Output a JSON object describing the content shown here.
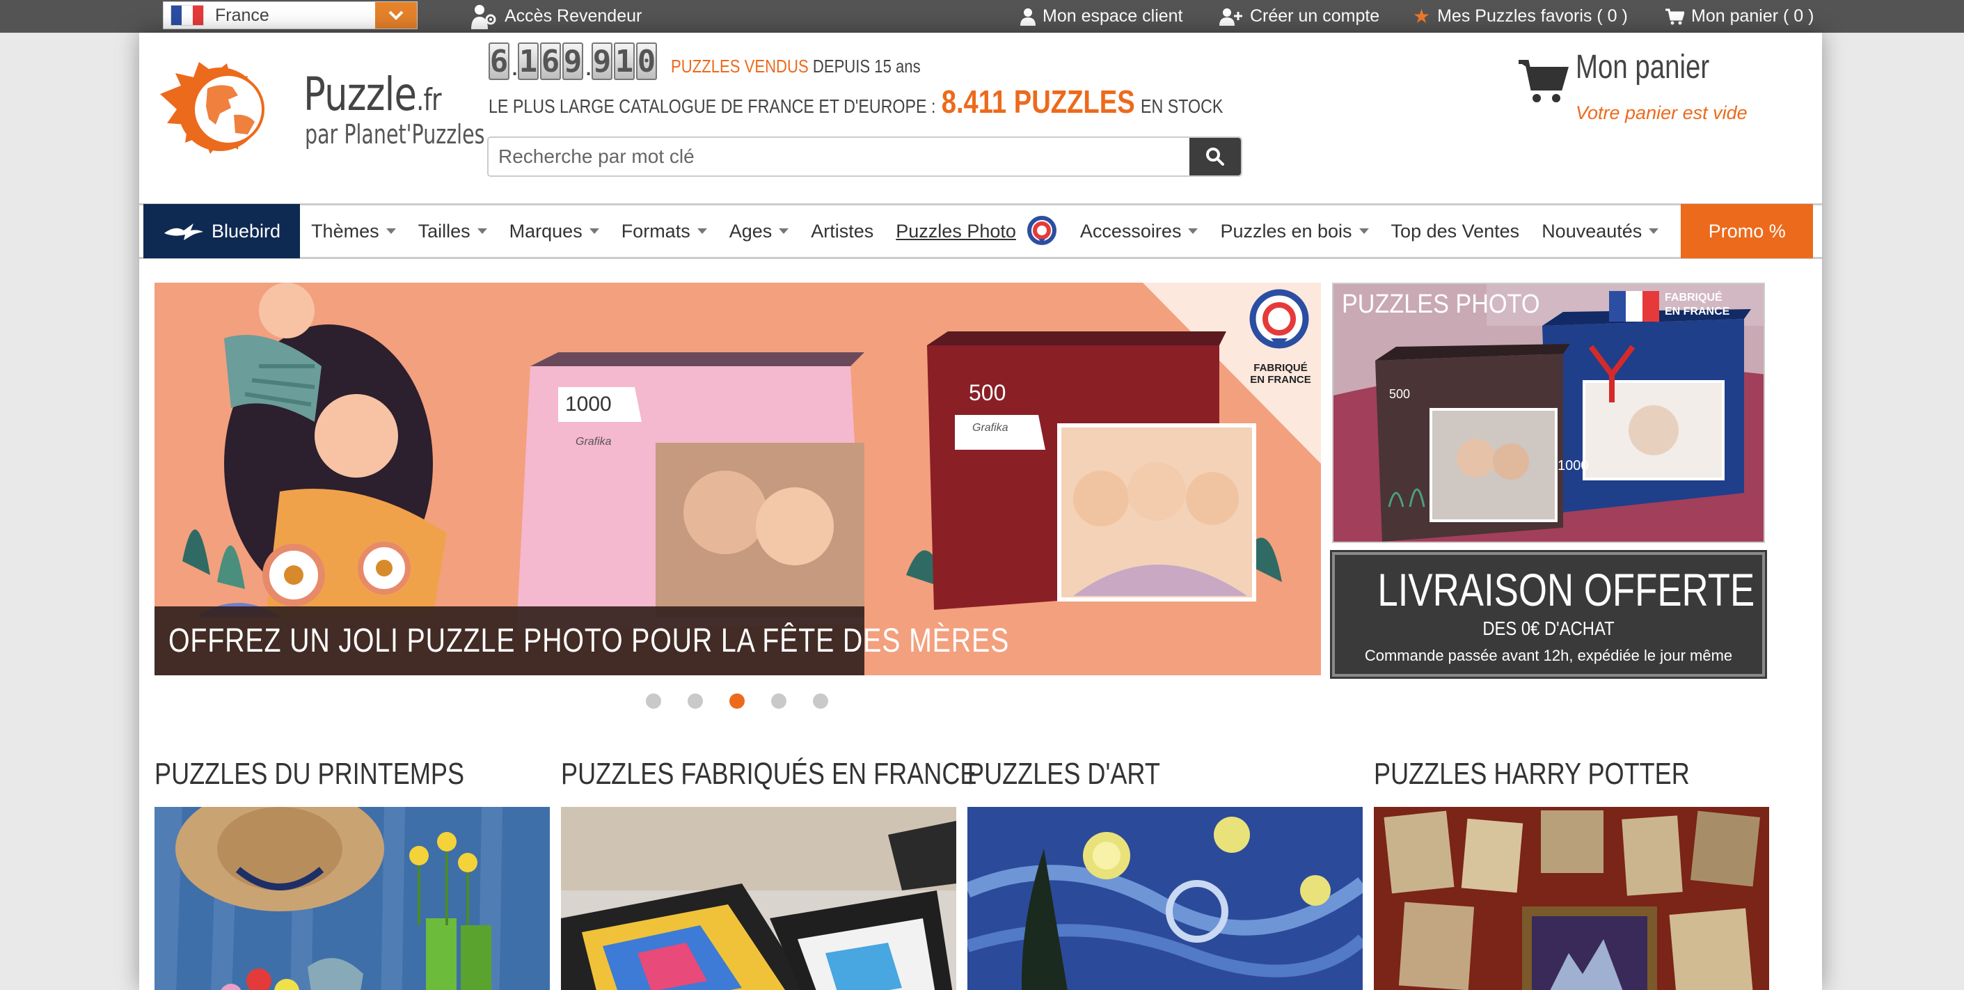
{
  "topbar": {
    "country": "France",
    "reseller": "Accès Revendeur",
    "account": "Mon espace client",
    "create_account": "Créer un compte",
    "favorites": "Mes Puzzles favoris ( 0 )",
    "cart": "Mon panier ( 0 )"
  },
  "header": {
    "logo_main": "Puzzle",
    "logo_tld": ".fr",
    "logo_sub": "par Planet'Puzzles",
    "counter_digits": [
      "6",
      "1",
      "6",
      "9",
      "9",
      "1",
      "0"
    ],
    "counter_sep": ".",
    "sold_label": "PUZZLES VENDUS",
    "since_label": "DEPUIS 15 ans",
    "catalog_label": "LE PLUS LARGE CATALOGUE DE FRANCE ET D'EUROPE :",
    "stock_count": "8.411 PUZZLES",
    "stock_label": "EN STOCK",
    "search_placeholder": "Recherche par mot clé",
    "cart_title": "Mon panier",
    "cart_status": "Votre panier est vide"
  },
  "nav": {
    "bluebird": "Bluebird",
    "items": [
      "Thèmes",
      "Tailles",
      "Marques",
      "Formats",
      "Ages",
      "Artistes",
      "Puzzles Photo",
      "Accessoires",
      "Puzzles en bois",
      "Top des Ventes",
      "Nouveautés"
    ],
    "promo": "Promo %"
  },
  "banner": {
    "caption": "OFFREZ UN JOLI PUZZLE PHOTO POUR LA FÊTE DES MÈRES",
    "box1_count": "1000",
    "box2_count": "500",
    "badge_line1": "FABRIQUÉ",
    "badge_line2": "EN FRANCE",
    "brand": "Grafika",
    "slides": 5,
    "active_slide": 3
  },
  "side_banner": {
    "title": "PUZZLES PHOTO",
    "badge_line1": "FABRIQUÉ",
    "badge_line2": "EN FRANCE",
    "box1_count": "500",
    "box2_count": "1000"
  },
  "delivery": {
    "title": "LIVRAISON OFFERTE",
    "subtitle": "DES 0€ D'ACHAT",
    "note": "Commande passée avant 12h, expédiée le jour même"
  },
  "categories": [
    {
      "title": "PUZZLES DU PRINTEMPS"
    },
    {
      "title": "PUZZLES FABRIQUÉS EN FRANCE"
    },
    {
      "title": "PUZZLES D'ART"
    },
    {
      "title": "PUZZLES HARRY POTTER"
    }
  ],
  "colors": {
    "accent": "#ec6a1c",
    "topbar": "#545454",
    "bluebird": "#0f2a52"
  }
}
